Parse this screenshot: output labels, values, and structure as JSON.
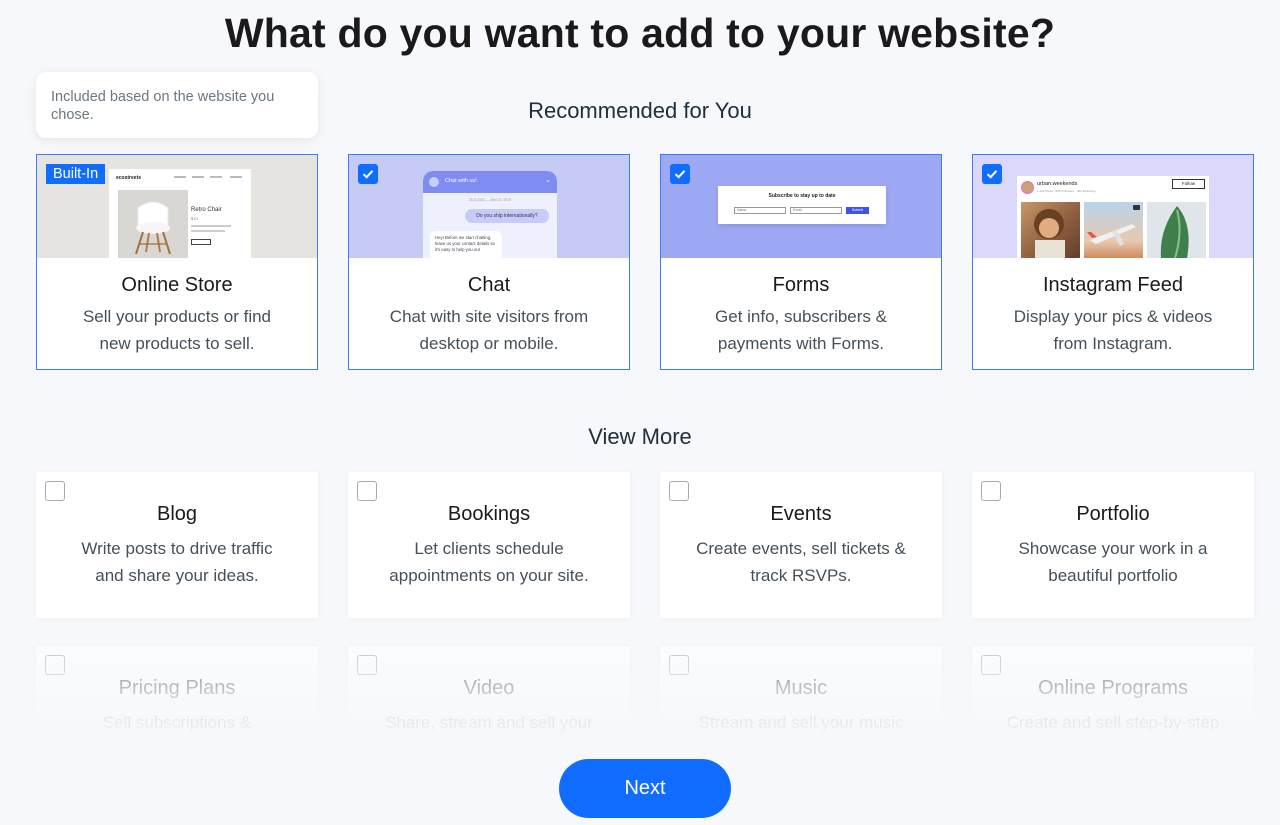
{
  "page": {
    "title": "What do you want to add to your website?"
  },
  "tooltip": {
    "text": "Included based on the website you chose."
  },
  "recommended": {
    "heading": "Recommended for You",
    "cards": [
      {
        "name": "Online Store",
        "desc_line1": "Sell your products or find",
        "desc_line2": "new products to sell.",
        "badge": "Built-In",
        "checked": true,
        "thumb_texts": {
          "brand": "ecostreets",
          "product": "Retro Chair",
          "price": "$70"
        }
      },
      {
        "name": "Chat",
        "desc_line1": "Chat with site visitors from",
        "desc_line2": "desktop or mobile.",
        "checked": true,
        "thumb_texts": {
          "header": "Chat with us!",
          "date": "26.8.2018 — JAN 22, 2019",
          "question": "Do you ship internationally?",
          "reply": "Hey! Before we start chatting, leave us your contact details so it's easy to help you out"
        }
      },
      {
        "name": "Forms",
        "desc_line1": "Get info, subscribers &",
        "desc_line2": "payments with Forms.",
        "checked": true,
        "thumb_texts": {
          "title": "Subscribe to stay up to date",
          "field1": "Name",
          "field2": "Email",
          "submit": "Submit"
        }
      },
      {
        "name": "Instagram Feed",
        "desc_line1": "Display your pics & videos",
        "desc_line2": "from Instagram.",
        "checked": true,
        "thumb_texts": {
          "account": "urban.weekends",
          "stats": "1,234 Posts · 856 Followers · 480 Following",
          "follow": "Follow"
        }
      }
    ]
  },
  "view_more": {
    "heading": "View More",
    "cards": [
      {
        "name": "Blog",
        "desc_line1": "Write posts to drive traffic",
        "desc_line2": "and share your ideas."
      },
      {
        "name": "Bookings",
        "desc_line1": "Let clients schedule",
        "desc_line2": "appointments on your site."
      },
      {
        "name": "Events",
        "desc_line1": "Create events, sell tickets &",
        "desc_line2": "track RSVPs."
      },
      {
        "name": "Portfolio",
        "desc_line1": "Showcase your work in a",
        "desc_line2": "beautiful portfolio"
      },
      {
        "name": "Pricing Plans",
        "desc_line1": "Sell subscriptions &"
      },
      {
        "name": "Video",
        "desc_line1": "Share, stream and sell your"
      },
      {
        "name": "Music",
        "desc_line1": "Stream and sell your music"
      },
      {
        "name": "Online Programs",
        "desc_line1": "Create and sell step-by-step"
      }
    ]
  },
  "footer": {
    "next_label": "Next"
  },
  "colors": {
    "accent": "#116dff",
    "card_border_selected": "#3b7ef0",
    "background": "#f6f8fb"
  },
  "icons": {
    "checkbox_checked": "check-icon",
    "checkbox_unchecked": "checkbox-empty-icon"
  }
}
